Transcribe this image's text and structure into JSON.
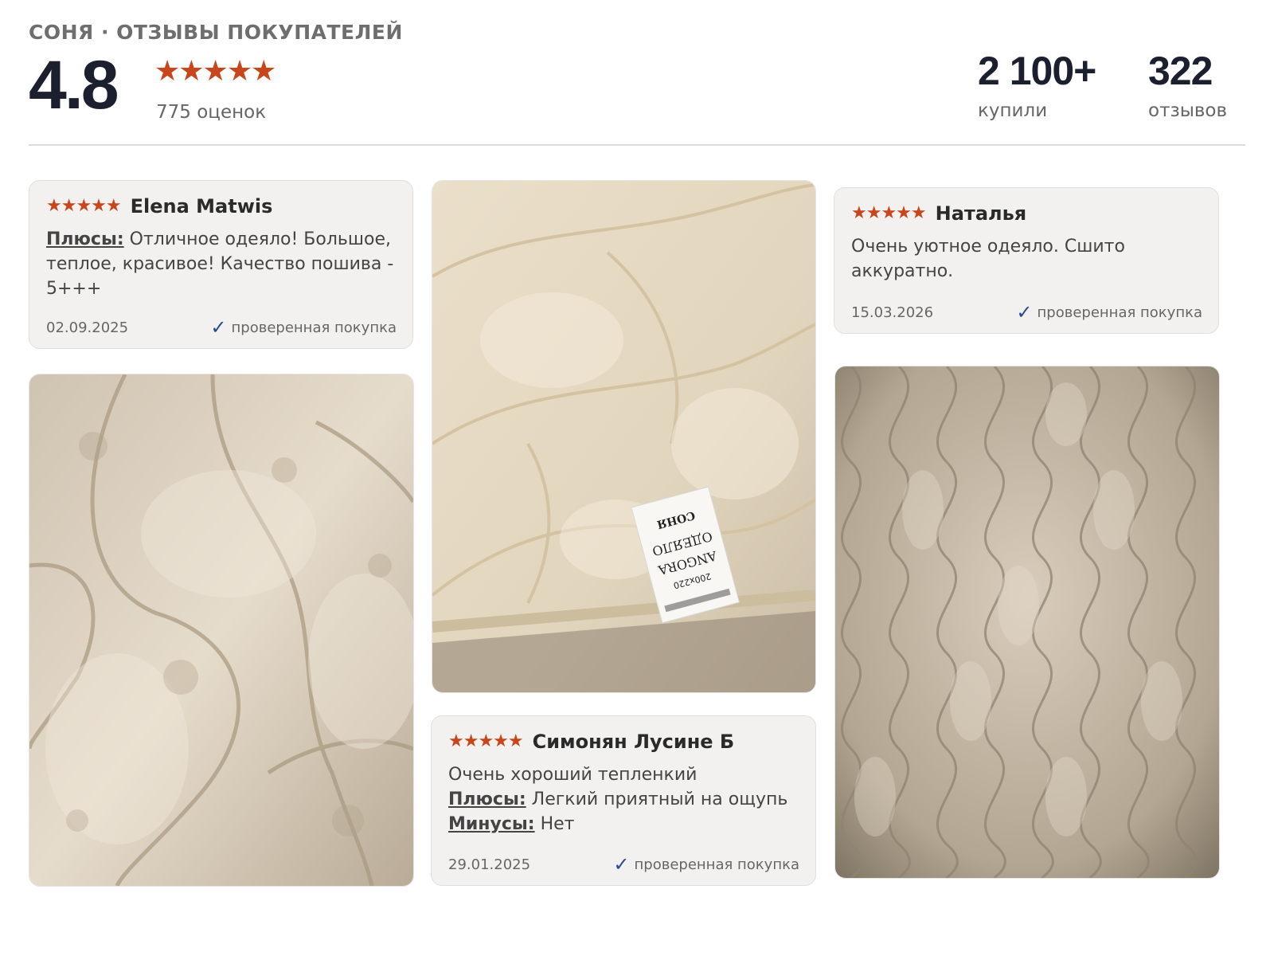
{
  "header": {
    "brand": "СОНЯ · ОТЗЫВЫ ПОКУПАТЕЛЕЙ",
    "rating": "4.8",
    "stars": "★★★★★",
    "ratings_count": "775 оценок",
    "bought_value": "2 100+",
    "bought_label": "купили",
    "reviews_value": "322",
    "reviews_label": "отзывов"
  },
  "reviews": [
    {
      "stars": "★★★★★",
      "author": "Elena Matwis",
      "pros_label": "Плюсы:",
      "pros": " Отличное одеяло! Большое, теплое, красивое! Качество пошива - 5+++",
      "date": "02.09.2025",
      "verified": "проверенная покупка"
    },
    {
      "stars": "★★★★★",
      "author": "Наталья",
      "text": "Очень уютное одеяло. Сшито аккуратно.",
      "date": "15.03.2026",
      "verified": "проверенная покупка"
    },
    {
      "stars": "★★★★★",
      "author": "Симонян Лусине Б",
      "text": "Очень хороший тепленкий",
      "pros_label": "Плюсы:",
      "pros": " Легкий приятный на ощупь",
      "cons_label": "Минусы:",
      "cons": " Нет",
      "date": "29.01.2025",
      "verified": "проверенная покупка"
    }
  ],
  "photo_label": {
    "brand": "СОНЯ",
    "line1": "ОДЕЯЛО",
    "line2": "ANGORA",
    "size": "200x220"
  },
  "icons": {
    "star": "star-icon",
    "check": "checkmark-icon"
  },
  "colors": {
    "star": "#c8461c",
    "check": "#2a4a8f",
    "card_bg": "#f2f1ef",
    "title": "#1c1f2e"
  }
}
